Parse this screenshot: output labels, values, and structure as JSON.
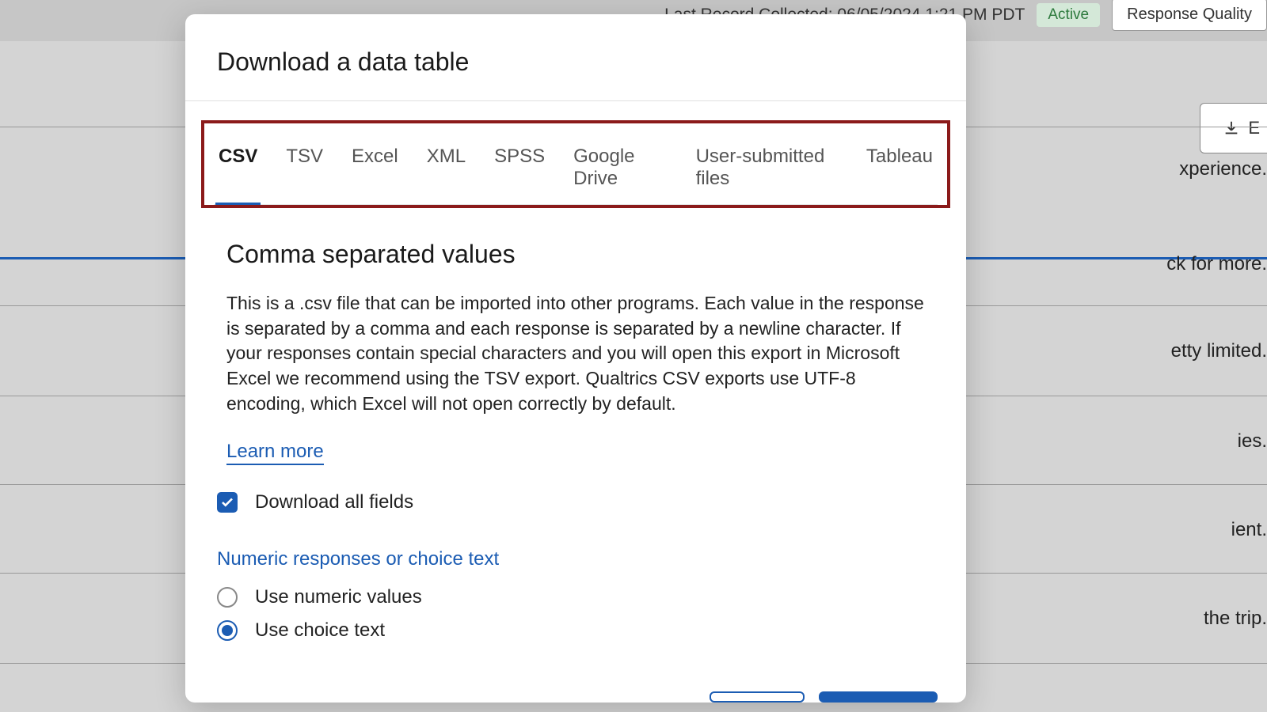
{
  "background": {
    "last_record_text": "Last Record Collected: 06/05/2024 1:21 PM PDT",
    "status_badge": "Active",
    "response_quality_btn": "Response Quality",
    "export_btn": "E",
    "text_lines": [
      "xperience.",
      "ck for more.",
      "etty limited.",
      "ies.",
      "ient.",
      "the trip."
    ]
  },
  "modal": {
    "title": "Download a data table",
    "tabs": {
      "csv": "CSV",
      "tsv": "TSV",
      "excel": "Excel",
      "xml": "XML",
      "spss": "SPSS",
      "google_drive": "Google Drive",
      "user_files": "User-submitted files",
      "tableau": "Tableau"
    },
    "section": {
      "title": "Comma separated values",
      "description": "This is a .csv file that can be imported into other programs. Each value in the response is separated by a comma and each response is separated by a newline character. If your responses contain special characters and you will open this export in Microsoft Excel we recommend using the TSV export. Qualtrics CSV exports use UTF-8 encoding, which Excel will not open correctly by default.",
      "learn_more": "Learn more",
      "download_all_fields": "Download all fields",
      "option_group_title": "Numeric responses or choice text",
      "use_numeric": "Use numeric values",
      "use_choice_text": "Use choice text"
    }
  }
}
